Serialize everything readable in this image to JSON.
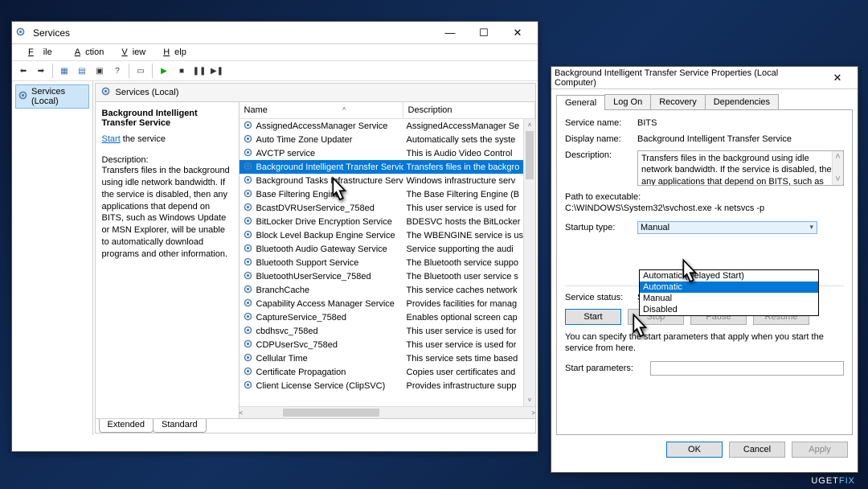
{
  "services_window": {
    "title": "Services",
    "menus": {
      "file": "File",
      "action": "Action",
      "view": "View",
      "help": "Help"
    },
    "sidebar_item": "Services (Local)",
    "panel_title": "Services (Local)",
    "detail": {
      "name": "Background Intelligent Transfer Service",
      "start_link": "Start",
      "start_suffix": " the service",
      "desc_label": "Description:",
      "description": "Transfers files in the background using idle network bandwidth. If the service is disabled, then any applications that depend on BITS, such as Windows Update or MSN Explorer, will be unable to automatically download programs and other information."
    },
    "columns": {
      "name": "Name",
      "description": "Description"
    },
    "rows": [
      {
        "name": "AssignedAccessManager Service",
        "desc": "AssignedAccessManager Se"
      },
      {
        "name": "Auto Time Zone Updater",
        "desc": "Automatically sets the syste"
      },
      {
        "name": "AVCTP service",
        "desc": "This is Audio Video Control"
      },
      {
        "name": "Background Intelligent Transfer Service",
        "desc": "Transfers files in the backgro",
        "selected": true
      },
      {
        "name": "Background Tasks Infrastructure Service",
        "desc": "Windows infrastructure serv"
      },
      {
        "name": "Base Filtering Engine",
        "desc": "The Base Filtering Engine (B"
      },
      {
        "name": "BcastDVRUserService_758ed",
        "desc": "This user service is used for"
      },
      {
        "name": "BitLocker Drive Encryption Service",
        "desc": "BDESVC hosts the BitLocker"
      },
      {
        "name": "Block Level Backup Engine Service",
        "desc": "The WBENGINE service is us"
      },
      {
        "name": "Bluetooth Audio Gateway Service",
        "desc": "Service supporting the audi"
      },
      {
        "name": "Bluetooth Support Service",
        "desc": "The Bluetooth service suppo"
      },
      {
        "name": "BluetoothUserService_758ed",
        "desc": "The Bluetooth user service s"
      },
      {
        "name": "BranchCache",
        "desc": "This service caches network"
      },
      {
        "name": "Capability Access Manager Service",
        "desc": "Provides facilities for manag"
      },
      {
        "name": "CaptureService_758ed",
        "desc": "Enables optional screen cap"
      },
      {
        "name": "cbdhsvc_758ed",
        "desc": "This user service is used for"
      },
      {
        "name": "CDPUserSvc_758ed",
        "desc": "This user service is used for"
      },
      {
        "name": "Cellular Time",
        "desc": "This service sets time based"
      },
      {
        "name": "Certificate Propagation",
        "desc": "Copies user certificates and"
      },
      {
        "name": "Client License Service (ClipSVC)",
        "desc": "Provides infrastructure supp"
      }
    ],
    "footer_tabs": {
      "extended": "Extended",
      "standard": "Standard"
    }
  },
  "props_dialog": {
    "title": "Background Intelligent Transfer Service Properties (Local Computer)",
    "tabs": {
      "general": "General",
      "logon": "Log On",
      "recovery": "Recovery",
      "dependencies": "Dependencies"
    },
    "labels": {
      "service_name": "Service name:",
      "display_name": "Display name:",
      "description": "Description:",
      "path": "Path to executable:",
      "startup_type": "Startup type:",
      "service_status": "Service status:",
      "start_params": "Start parameters:"
    },
    "values": {
      "service_name": "BITS",
      "display_name": "Background Intelligent Transfer Service",
      "description": "Transfers files in the background using idle network bandwidth. If the service is disabled, then any applications that depend on BITS, such as Windows",
      "path": "C:\\WINDOWS\\System32\\svchost.exe -k netsvcs -p",
      "startup_selected": "Manual",
      "service_status": "Stopped"
    },
    "startup_options": [
      "Automatic (Delayed Start)",
      "Automatic",
      "Manual",
      "Disabled"
    ],
    "buttons": {
      "start": "Start",
      "stop": "Stop",
      "pause": "Pause",
      "resume": "Resume",
      "ok": "OK",
      "cancel": "Cancel",
      "apply": "Apply"
    },
    "help_text": "You can specify the start parameters that apply when you start the service from here."
  },
  "watermark": {
    "pre": "UGET",
    "suf": "FIX"
  }
}
